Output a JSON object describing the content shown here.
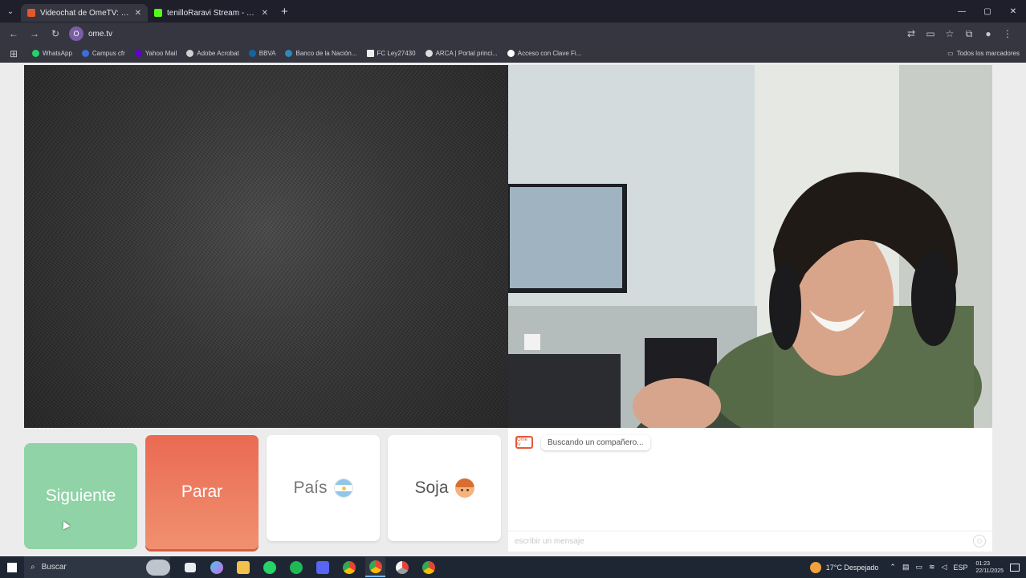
{
  "browser": {
    "tabs": [
      {
        "title": "Videochat de OmeTV: una ...",
        "active": true,
        "favicon_color": "#e4582e"
      },
      {
        "title": "tenilloRaravi Stream - Watch ...",
        "active": false,
        "favicon_color": "#53fc18"
      }
    ],
    "new_tab": "+",
    "url": "ome.tv",
    "site_icon_letter": "O",
    "window_controls": [
      "—",
      "▢",
      "✕"
    ]
  },
  "bookmarks": {
    "items": [
      {
        "label": "WhatsApp",
        "color": "#25d366"
      },
      {
        "label": "Campus cfr",
        "color": "#3b6fd6"
      },
      {
        "label": "Yahoo Mail",
        "color": "#6001d2"
      },
      {
        "label": "Adobe Acrobat",
        "color": "#d0d0d0"
      },
      {
        "label": "BBVA",
        "color": "#1464a5"
      },
      {
        "label": "Banco de la Nación...",
        "color": "#2e8ab8"
      },
      {
        "label": "FC Ley27430",
        "color": "#eeeeee"
      },
      {
        "label": "ARCA | Portal princi...",
        "color": "#dddddd"
      },
      {
        "label": "Acceso con Clave Fi...",
        "color": "#ffffff"
      }
    ],
    "all_label": "Todos los marcadores"
  },
  "controls": {
    "next_label": "Siguiente",
    "stop_label": "Parar",
    "country_label": "País",
    "gender_label": "Soja"
  },
  "chat": {
    "logo_text": "Ome tv",
    "status_message": "Buscando un compañero...",
    "input_placeholder": "escribir un mensaje"
  },
  "taskbar": {
    "search_label": "Buscar",
    "weather": "17°C  Despejado",
    "lang": "ESP",
    "time": "01:23",
    "date": "22/11/2025"
  },
  "colors": {
    "next": "#8fd3a6",
    "stop": "#ea6a53",
    "accent": "#e45a3c"
  }
}
